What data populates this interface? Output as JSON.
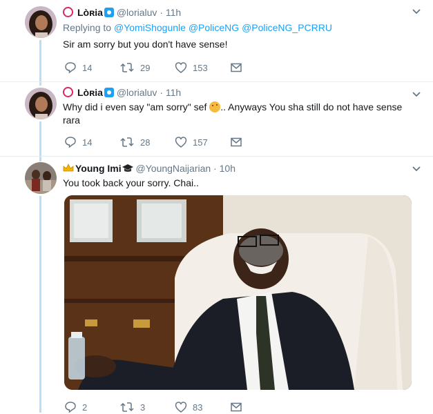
{
  "tweets": [
    {
      "name": "Lòʀia",
      "handle": "@lorialuv",
      "time": "11h",
      "replying_label": "Replying to",
      "mentions": [
        "@YomiShogunle",
        "@PoliceNG",
        "@PoliceNG_PCRRU"
      ],
      "text": "Sir am sorry but you don't have sense!",
      "replies": "14",
      "retweets": "29",
      "likes": "153"
    },
    {
      "name": "Lòʀia",
      "handle": "@lorialuv",
      "time": "11h",
      "text_before": "Why did i even say \"am sorry\" sef",
      "text_after": ".. Anyways You sha still do not have sense",
      "text_line2": "rara",
      "replies": "14",
      "retweets": "28",
      "likes": "157"
    },
    {
      "name": "Young Imi",
      "handle": "@YoungNaijarian",
      "time": "10h",
      "text": "You took back your sorry. Chai..",
      "replies": "2",
      "retweets": "3",
      "likes": "83"
    }
  ],
  "dot": "·",
  "icons": {
    "reply": "reply-icon",
    "retweet": "retweet-icon",
    "like": "heart-icon",
    "dm": "envelope-icon",
    "caret": "chevron-down-icon"
  },
  "colors": {
    "accent": "#1da1f2",
    "muted": "#657786",
    "thread": "#b7dff7"
  }
}
